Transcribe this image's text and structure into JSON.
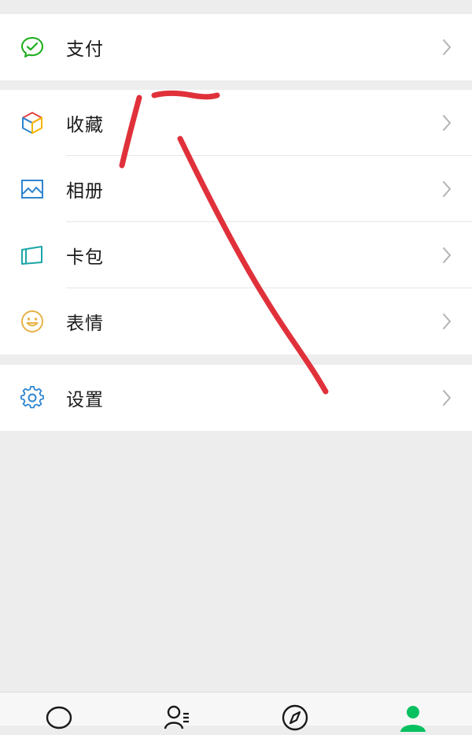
{
  "menu": {
    "pay": {
      "label": "支付",
      "icon": "wechat-pay-icon"
    },
    "items": [
      {
        "label": "收藏",
        "icon": "favorites-cube-icon"
      },
      {
        "label": "相册",
        "icon": "album-photo-icon"
      },
      {
        "label": "卡包",
        "icon": "card-wallet-icon"
      },
      {
        "label": "表情",
        "icon": "sticker-smiley-icon"
      }
    ],
    "settings": {
      "label": "设置",
      "icon": "gear-icon"
    }
  },
  "tabbar": {
    "tabs": [
      {
        "icon": "chats-bubble-icon",
        "active": false
      },
      {
        "icon": "contacts-icon",
        "active": false
      },
      {
        "icon": "discover-compass-icon",
        "active": false
      },
      {
        "icon": "me-person-icon",
        "active": true
      }
    ]
  },
  "colors": {
    "background": "#ededed",
    "accent_green": "#07c160",
    "annotation_red": "#e0313b",
    "chevron_gray": "#b2b2b2"
  }
}
